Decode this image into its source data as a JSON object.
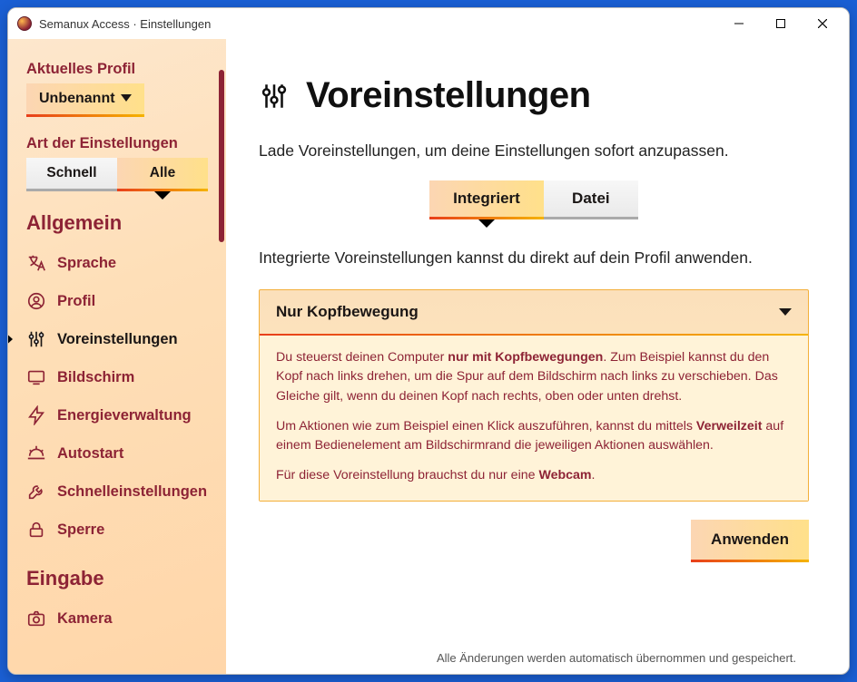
{
  "window": {
    "title": "Semanux Access · Einstellungen"
  },
  "sidebar": {
    "profile_section": "Aktuelles Profil",
    "profile_name": "Unbenannt",
    "settings_type_section": "Art der Einstellungen",
    "settings_type_tabs": {
      "quick": "Schnell",
      "all": "Alle"
    },
    "category_general": "Allgemein",
    "category_input": "Eingabe",
    "nav": {
      "language": "Sprache",
      "profile": "Profil",
      "presets": "Voreinstellungen",
      "screen": "Bildschirm",
      "power": "Energieverwaltung",
      "autostart": "Autostart",
      "quicksettings": "Schnelleinstellungen",
      "lock": "Sperre",
      "camera": "Kamera"
    }
  },
  "main": {
    "title": "Voreinstellungen",
    "lead": "Lade Voreinstellungen, um deine Einstellungen sofort anzupassen.",
    "source_tabs": {
      "integrated": "Integriert",
      "file": "Datei"
    },
    "sub": "Integrierte Voreinstellungen kannst du direkt auf dein Profil anwenden.",
    "preset": {
      "title": "Nur Kopfbewegung",
      "p1_a": "Du steuerst deinen Computer ",
      "p1_b": "nur mit Kopfbewegungen",
      "p1_c": ". Zum Beispiel kannst du den Kopf nach links drehen, um die Spur auf dem Bildschirm nach links zu verschieben. Das Gleiche gilt, wenn du deinen Kopf nach rechts, oben oder unten drehst.",
      "p2_a": "Um Aktionen wie zum Beispiel einen Klick auszuführen, kannst du mittels ",
      "p2_b": "Verweilzeit",
      "p2_c": " auf einem Bedienelement am Bildschirmrand die jeweiligen Aktionen auswählen.",
      "p3_a": "Für diese Voreinstellung brauchst du nur eine ",
      "p3_b": "Webcam",
      "p3_c": "."
    },
    "apply": "Anwenden",
    "footer": "Alle Änderungen werden automatisch übernommen und gespeichert."
  }
}
